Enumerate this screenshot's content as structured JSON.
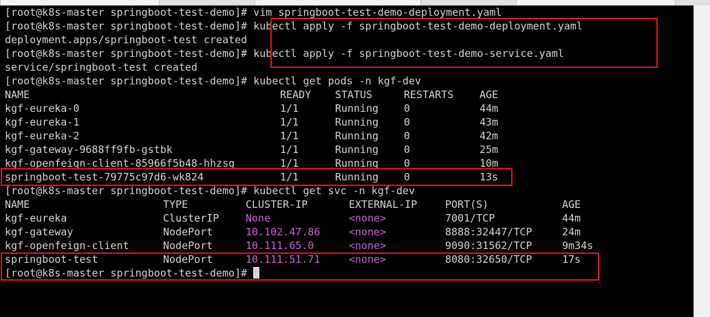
{
  "terminal": {
    "lines": [
      "[root@k8s-master springboot-test-demo]# vim springboot-test-demo-deployment.yaml",
      "[root@k8s-master springboot-test-demo]# kubectl apply -f springboot-test-demo-deployment.yaml",
      "deployment.apps/springboot-test created",
      "[root@k8s-master springboot-test-demo]# kubectl apply -f springboot-test-demo-service.yaml",
      "service/springboot-test created",
      "[root@k8s-master springboot-test-demo]# kubectl get pods -n kgf-dev"
    ],
    "pods_table": {
      "headers": [
        "NAME",
        "READY",
        "STATUS",
        "RESTARTS",
        "AGE"
      ],
      "rows": [
        [
          "kgf-eureka-0",
          "1/1",
          "Running",
          "0",
          "44m"
        ],
        [
          "kgf-eureka-1",
          "1/1",
          "Running",
          "0",
          "43m"
        ],
        [
          "kgf-eureka-2",
          "1/1",
          "Running",
          "0",
          "42m"
        ],
        [
          "kgf-gateway-9688ff9fb-gstbk",
          "1/1",
          "Running",
          "0",
          "25m"
        ],
        [
          "kgf-openfeign-client-85966f5b48-hhzsg",
          "1/1",
          "Running",
          "0",
          "10m"
        ],
        [
          "springboot-test-79775c97d6-wk824",
          "1/1",
          "Running",
          "0",
          "13s"
        ]
      ]
    },
    "svc_command": "[root@k8s-master springboot-test-demo]# kubectl get svc -n kgf-dev",
    "svc_table": {
      "headers": [
        "NAME",
        "TYPE",
        "CLUSTER-IP",
        "EXTERNAL-IP",
        "PORT(S)",
        "AGE"
      ],
      "rows": [
        [
          "kgf-eureka",
          "ClusterIP",
          "None",
          "<none>",
          "7001/TCP",
          "44m"
        ],
        [
          "kgf-gateway",
          "NodePort",
          "10.102.47.86",
          "<none>",
          "8888:32447/TCP",
          "24m"
        ],
        [
          "kgf-openfeign-client",
          "NodePort",
          "10.111.65.0",
          "<none>",
          "9090:31562/TCP",
          "9m34s"
        ],
        [
          "springboot-test",
          "NodePort",
          "10.111.51.71",
          "<none>",
          "8080:32650/TCP",
          "17s"
        ]
      ]
    },
    "prompt": "[root@k8s-master springboot-test-demo]# "
  },
  "colors": {
    "background": "#000000",
    "foreground": "#d4d4d4",
    "highlight_ip": "#d25bd6",
    "annotation_box": "#e3151a"
  }
}
